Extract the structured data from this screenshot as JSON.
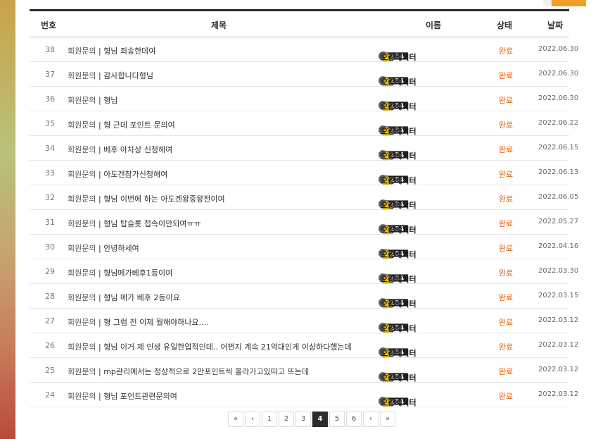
{
  "header": {
    "num": "번호",
    "title": "제목",
    "name": "이름",
    "state": "상태",
    "date": "날짜"
  },
  "author": {
    "level": "284",
    "name": "오공베지터"
  },
  "rows": [
    {
      "num": "38",
      "category": "회원문의",
      "title": "형님 죄송한데여",
      "state": "완료",
      "date": "2022.06.30"
    },
    {
      "num": "37",
      "category": "회원문의",
      "title": "감사합니다형님",
      "state": "완료",
      "date": "2022.06.30"
    },
    {
      "num": "36",
      "category": "회원문의",
      "title": "형님",
      "state": "완료",
      "date": "2022.06.30"
    },
    {
      "num": "35",
      "category": "회원문의",
      "title": "형 근데 포인트 문의여",
      "state": "완료",
      "date": "2022.06.22"
    },
    {
      "num": "34",
      "category": "회원문의",
      "title": "베후 아차상 신청해여",
      "state": "완료",
      "date": "2022.06.15"
    },
    {
      "num": "33",
      "category": "회원문의",
      "title": "아도겐참가신청해여",
      "state": "완료",
      "date": "2022.06.13"
    },
    {
      "num": "32",
      "category": "회원문의",
      "title": "형님 이번에 하는 아도겐왕중왕전이여",
      "state": "완료",
      "date": "2022.06.05"
    },
    {
      "num": "31",
      "category": "회원문의",
      "title": "형님 탑슬롯 접속이안되여ㅠㅠ",
      "state": "완료",
      "date": "2022.05.27"
    },
    {
      "num": "30",
      "category": "회원문의",
      "title": "안녕하세여",
      "state": "완료",
      "date": "2022.04.16"
    },
    {
      "num": "29",
      "category": "회원문의",
      "title": "형님메가베후1등이여",
      "state": "완료",
      "date": "2022.03.30"
    },
    {
      "num": "28",
      "category": "회원문의",
      "title": "형님 메가 베후 2등이요",
      "state": "완료",
      "date": "2022.03.15"
    },
    {
      "num": "27",
      "category": "회원문의",
      "title": "형 그럼 전 이제 뭘해야하나요....",
      "state": "완료",
      "date": "2022.03.12"
    },
    {
      "num": "26",
      "category": "회원문의",
      "title": "형님 이거 제 인생 유일한업적인데.. 어쩐지 계속 21억대인게 이상하다했는데",
      "state": "완료",
      "date": "2022.03.12"
    },
    {
      "num": "25",
      "category": "회원문의",
      "title": "mp관리에서는 정상적으로 2만포인트씩 올라가고있따고 뜨는데",
      "state": "완료",
      "date": "2022.03.12"
    },
    {
      "num": "24",
      "category": "회원문의",
      "title": "형님 포인트관련문의여",
      "state": "완료",
      "date": "2022.03.12"
    }
  ],
  "separator": " | ",
  "pagination": {
    "first": "«",
    "prev": "‹",
    "pages": [
      "1",
      "2",
      "3",
      "4",
      "5",
      "6"
    ],
    "current": "4",
    "next": "›",
    "last": "»"
  },
  "colors": {
    "accent": "#f0a02a",
    "status": "#e8600e",
    "header_bar": "#2b2b2b"
  },
  "icons": {
    "level_badge": "gear-level-badge-icon",
    "avatar": "yellow-bird-icon"
  }
}
